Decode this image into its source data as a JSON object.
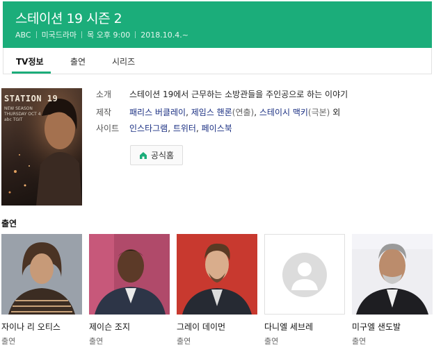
{
  "header": {
    "title": "스테이션 19 시즌 2",
    "meta": [
      "ABC",
      "미국드라마",
      "목 오후 9:00",
      "2018.10.4.~"
    ]
  },
  "tabs": [
    {
      "label": "TV정보",
      "active": true
    },
    {
      "label": "출연",
      "active": false
    },
    {
      "label": "시리즈",
      "active": false
    }
  ],
  "poster": {
    "title": "STATION 19",
    "sub_text": "NEW SEASON\nTHURSDAY OCT 4\nabc TGIT"
  },
  "info": {
    "intro_label": "소개",
    "intro_value": "스테이션 19에서 근무하는 소방관들을 주인공으로 하는 이야기",
    "production_label": "제작",
    "production": {
      "person1": "패리스 버클레이",
      "sep1": ", ",
      "person2": "제임스 핸론",
      "role2": "(연출)",
      "sep2": ", ",
      "person3": "스테이시 맥키",
      "role3": "(극본)",
      "suffix": " 외"
    },
    "site_label": "사이트",
    "sites": [
      "인스타그램",
      "트위터",
      "페이스북"
    ],
    "site_sep": ", "
  },
  "home_button": {
    "label": "공식홈",
    "icon": "home-icon"
  },
  "cast_section": {
    "title": "출연",
    "members": [
      {
        "name": "자이나 리 오티스",
        "role": "출연"
      },
      {
        "name": "제이슨 조지",
        "role": "출연"
      },
      {
        "name": "그레이 데이먼",
        "role": "출연"
      },
      {
        "name": "다니엘 세브레",
        "role": "출연",
        "no_photo": true
      },
      {
        "name": "미구엘 샌도발",
        "role": "출연"
      }
    ]
  },
  "colors": {
    "brand": "#1bad7a",
    "link": "#1a2f82"
  }
}
